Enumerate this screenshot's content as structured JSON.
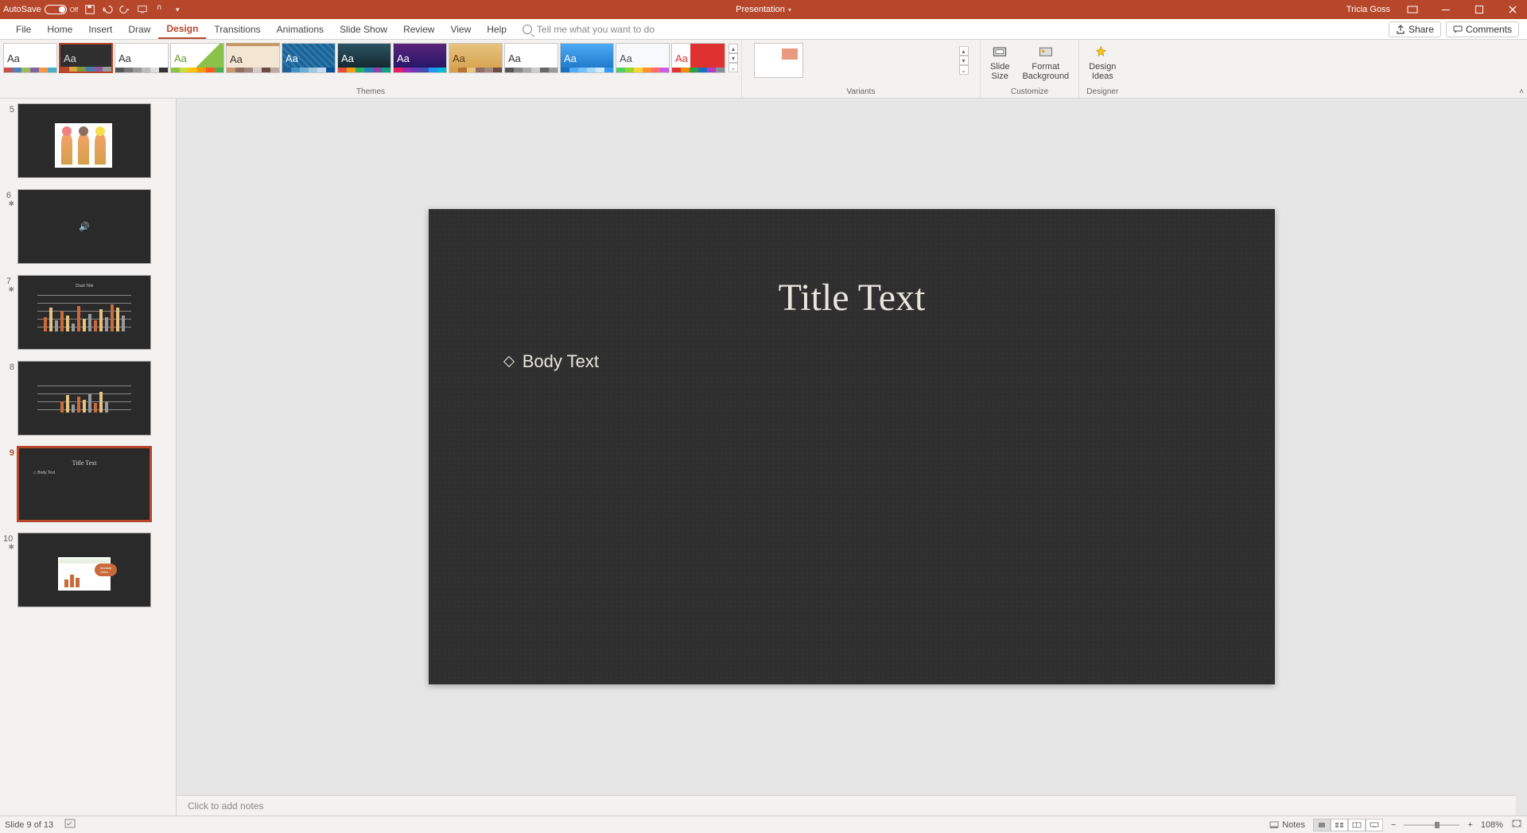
{
  "titlebar": {
    "autosave_label": "AutoSave",
    "autosave_state": "Off",
    "doc_title": "Presentation",
    "user_name": "Tricia Goss"
  },
  "tabs": {
    "file": "File",
    "home": "Home",
    "insert": "Insert",
    "draw": "Draw",
    "design": "Design",
    "transitions": "Transitions",
    "animations": "Animations",
    "slideshow": "Slide Show",
    "review": "Review",
    "view": "View",
    "help": "Help",
    "search_placeholder": "Tell me what you want to do",
    "share": "Share",
    "comments": "Comments"
  },
  "ribbon": {
    "themes_label": "Themes",
    "variants_label": "Variants",
    "customize_label": "Customize",
    "designer_label": "Designer",
    "slide_size": "Slide\nSize",
    "format_bg": "Format\nBackground",
    "design_ideas": "Design\nIdeas",
    "theme_sample": "Aa"
  },
  "thumbnails": {
    "t5": "5",
    "t6": "6",
    "t7": "7",
    "t8": "8",
    "t9": "9",
    "t10": "10"
  },
  "slide": {
    "title": "Title Text",
    "body": "Body Text"
  },
  "notes": {
    "placeholder": "Click to add notes"
  },
  "status": {
    "slide_pos": "Slide 9 of 13",
    "notes_btn": "Notes",
    "zoom_pct": "108%"
  },
  "colors": {
    "brand": "#b7472a"
  }
}
